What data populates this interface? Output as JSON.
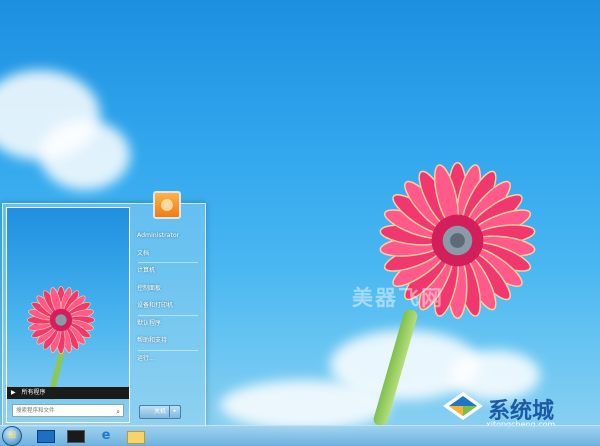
{
  "start_menu": {
    "user_name": "Administrator",
    "items": [
      "文档",
      "计算机",
      "控制面板",
      "设备和打印机",
      "默认程序",
      "帮助和支持",
      "运行..."
    ],
    "all_programs": "所有程序",
    "search_placeholder": "搜索程序和文件",
    "shutdown_label": "关机"
  },
  "watermark": "美器飞网",
  "logo": {
    "title": "系统城",
    "url": "xitongcheng.com"
  },
  "taskbar": {
    "pinned": [
      "start-orb",
      "desktop-icon",
      "media-icon",
      "ie-icon",
      "folder-icon"
    ]
  },
  "colors": {
    "sky": "#33a8ee",
    "flower": "#f0386f",
    "taskbar": "#8ec9ec"
  }
}
